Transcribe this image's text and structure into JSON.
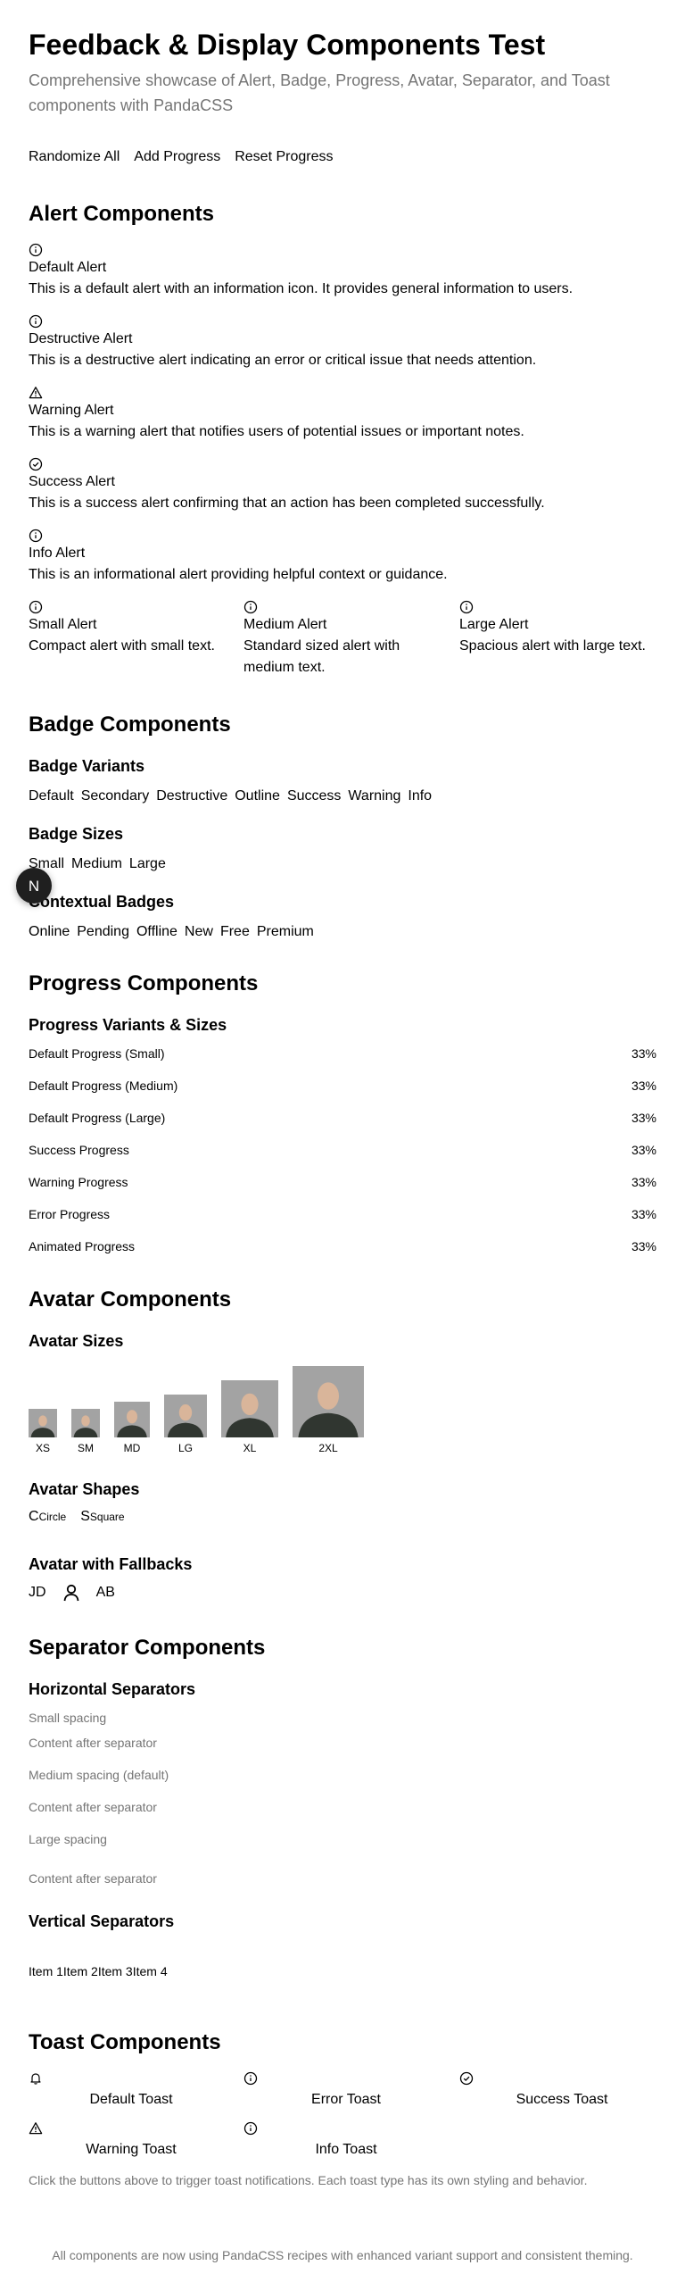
{
  "header": {
    "title": "Feedback & Display Components Test",
    "subtitle": "Comprehensive showcase of Alert, Badge, Progress, Avatar, Separator, and Toast components with PandaCSS"
  },
  "actions": {
    "randomize": "Randomize All",
    "add_progress": "Add Progress",
    "reset_progress": "Reset Progress"
  },
  "alerts": {
    "heading": "Alert Components",
    "items": [
      {
        "icon": "info-circle-icon",
        "title": "Default Alert",
        "desc": "This is a default alert with an information icon. It provides general information to users."
      },
      {
        "icon": "info-circle-icon",
        "title": "Destructive Alert",
        "desc": "This is a destructive alert indicating an error or critical issue that needs attention."
      },
      {
        "icon": "warning-triangle-icon",
        "title": "Warning Alert",
        "desc": "This is a warning alert that notifies users of potential issues or important notes."
      },
      {
        "icon": "check-circle-icon",
        "title": "Success Alert",
        "desc": "This is a success alert confirming that an action has been completed successfully."
      },
      {
        "icon": "info-circle-icon",
        "title": "Info Alert",
        "desc": "This is an informational alert providing helpful context or guidance."
      }
    ],
    "sizes": [
      {
        "title": "Small Alert",
        "desc": "Compact alert with small text."
      },
      {
        "title": "Medium Alert",
        "desc": "Standard sized alert with medium text."
      },
      {
        "title": "Large Alert",
        "desc": "Spacious alert with large text."
      }
    ]
  },
  "badges": {
    "heading": "Badge Components",
    "variants_heading": "Badge Variants",
    "variants": [
      "Default",
      "Secondary",
      "Destructive",
      "Outline",
      "Success",
      "Warning",
      "Info"
    ],
    "sizes_heading": "Badge Sizes",
    "sizes": [
      "Small",
      "Medium",
      "Large"
    ],
    "contextual_heading": "Contextual Badges",
    "contextual": [
      "Online",
      "Pending",
      "Offline",
      "New",
      "Free",
      "Premium"
    ]
  },
  "progress": {
    "heading": "Progress Components",
    "subheading": "Progress Variants & Sizes",
    "items": [
      {
        "label": "Default Progress (Small)",
        "value": "33%"
      },
      {
        "label": "Default Progress (Medium)",
        "value": "33%"
      },
      {
        "label": "Default Progress (Large)",
        "value": "33%"
      },
      {
        "label": "Success Progress",
        "value": "33%"
      },
      {
        "label": "Warning Progress",
        "value": "33%"
      },
      {
        "label": "Error Progress",
        "value": "33%"
      },
      {
        "label": "Animated Progress",
        "value": "33%"
      }
    ]
  },
  "avatars": {
    "heading": "Avatar Components",
    "sizes_heading": "Avatar Sizes",
    "sizes": [
      "XS",
      "SM",
      "MD",
      "LG",
      "XL",
      "2XL"
    ],
    "shapes_heading": "Avatar Shapes",
    "shapes": [
      {
        "initial": "C",
        "label": "Circle"
      },
      {
        "initial": "S",
        "label": "Square"
      }
    ],
    "fallbacks_heading": "Avatar with Fallbacks",
    "fallbacks": {
      "first": "JD",
      "icon": "user-icon",
      "last": "AB"
    }
  },
  "separators": {
    "heading": "Separator Components",
    "horizontal_heading": "Horizontal Separators",
    "small_spacing": "Small spacing",
    "content_after": "Content after separator",
    "medium_spacing": "Medium spacing (default)",
    "large_spacing": "Large spacing",
    "vertical_heading": "Vertical Separators",
    "vertical_items": [
      "Item 1",
      "Item 2",
      "Item 3",
      "Item 4"
    ]
  },
  "toasts": {
    "heading": "Toast Components",
    "items": [
      {
        "icon": "bell-icon",
        "label": "Default Toast"
      },
      {
        "icon": "info-circle-icon",
        "label": "Error Toast"
      },
      {
        "icon": "check-circle-icon",
        "label": "Success Toast"
      },
      {
        "icon": "warning-triangle-icon",
        "label": "Warning Toast"
      },
      {
        "icon": "info-circle-icon",
        "label": "Info Toast"
      }
    ],
    "note": "Click the buttons above to trigger toast notifications. Each toast type has its own styling and behavior."
  },
  "footer": {
    "text": "All components are now using PandaCSS recipes with enhanced variant support and consistent theming."
  },
  "dev_badge": {
    "letter": "N",
    "icon": "nextjs-logo-icon"
  }
}
